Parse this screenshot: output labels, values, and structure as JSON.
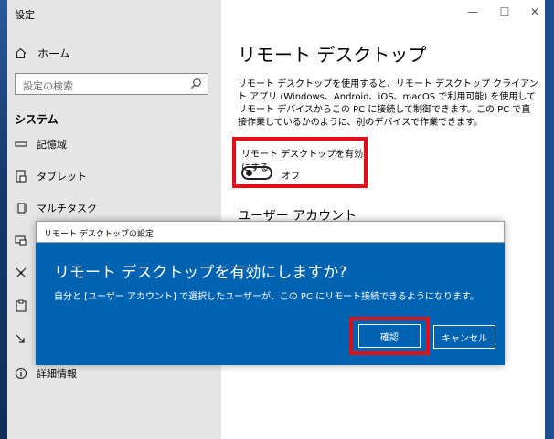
{
  "window": {
    "title": "設定",
    "caption": {
      "minimize": "—",
      "maximize": "☐",
      "close": "✕"
    }
  },
  "sidebar": {
    "home": "ホーム",
    "search_placeholder": "設定の検索",
    "section": "システム",
    "items": [
      {
        "label": "記憶域",
        "icon": "storage-icon"
      },
      {
        "label": "タブレット",
        "icon": "tablet-icon"
      },
      {
        "label": "マルチタスク",
        "icon": "multitask-icon"
      },
      {
        "label": "",
        "icon": "projection-icon"
      },
      {
        "label": "",
        "icon": "shared-experiences-icon"
      },
      {
        "label": "",
        "icon": "clipboard-icon"
      },
      {
        "label": "",
        "icon": "remote-desktop-icon"
      },
      {
        "label": "詳細情報",
        "icon": "info-icon"
      }
    ]
  },
  "main": {
    "title": "リモート デスクトップ",
    "description": "リモート デスクトップを使用すると、リモート デスクトップ クライアント アプリ (Windows、Android、iOS、macOS で利用可能) を使用してリモート デバイスからこの PC に接続して制御できます。この PC で直接作業しているかのように、別のデバイスで作業できます。",
    "toggle_label": "リモート デスクトップを有効にする",
    "toggle_state": "オフ",
    "user_accounts": "ユーザー アカウント"
  },
  "dialog": {
    "title": "リモート デスクトップの設定",
    "heading": "リモート デスクトップを有効にしますか?",
    "message": "自分と [ユーザー アカウント] で選択したユーザーが、この PC にリモート接続できるようになります。",
    "confirm": "確認",
    "cancel": "キャンセル"
  },
  "colors": {
    "dialog_bg": "#0063b1",
    "highlight": "#e01018",
    "sidebar_bg": "#e6e6e6"
  }
}
